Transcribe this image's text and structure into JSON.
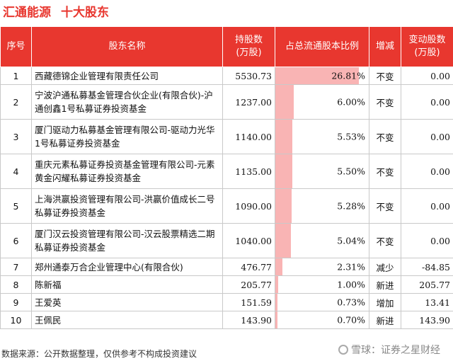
{
  "header": {
    "company": "汇通能源",
    "subtitle": "十大股东"
  },
  "columns": {
    "rank": "序号",
    "name": "股东名称",
    "holding": "持股数\n(万股)",
    "ratio": "占总流通股本比例",
    "change": "增减",
    "change_amount": "变动股数\n(万股)"
  },
  "colors": {
    "header_red": "#e8372f",
    "bar_pink": "#f9b4b4",
    "decrease_green": "#1e9c3a"
  },
  "chart_data": {
    "type": "table",
    "title": "汇通能源 十大股东",
    "rows": [
      {
        "rank": "1",
        "name": "西藏德锦企业管理有限责任公司",
        "holding": "5530.73",
        "ratio": "26.81%",
        "ratio_value": 26.81,
        "change": "不变",
        "change_type": "flat",
        "change_amount": "0.00",
        "tall": false
      },
      {
        "rank": "2",
        "name": "宁波沪通私募基金管理合伙企业(有限合伙)-沪通创鑫1号私募证券投资基金",
        "holding": "1237.00",
        "ratio": "6.00%",
        "ratio_value": 6.0,
        "change": "不变",
        "change_type": "flat",
        "change_amount": "0.00",
        "tall": true
      },
      {
        "rank": "3",
        "name": "厦门驱动力私募基金管理有限公司-驱动力光华1号私募证券投资基金",
        "holding": "1140.00",
        "ratio": "5.53%",
        "ratio_value": 5.53,
        "change": "不变",
        "change_type": "flat",
        "change_amount": "0.00",
        "tall": true
      },
      {
        "rank": "4",
        "name": "重庆元素私募证券投资基金管理有限公司-元素黄金闪耀私募证券投资基金",
        "holding": "1135.00",
        "ratio": "5.50%",
        "ratio_value": 5.5,
        "change": "不变",
        "change_type": "flat",
        "change_amount": "0.00",
        "tall": true
      },
      {
        "rank": "5",
        "name": "上海洪嬴投资管理有限公司-洪嬴价值成长二号私募证券投资基金",
        "holding": "1090.00",
        "ratio": "5.28%",
        "ratio_value": 5.28,
        "change": "不变",
        "change_type": "flat",
        "change_amount": "0.00",
        "tall": true
      },
      {
        "rank": "6",
        "name": "厦门汉云投资管理有限公司-汉云股票精选二期私募证券投资基金",
        "holding": "1040.00",
        "ratio": "5.04%",
        "ratio_value": 5.04,
        "change": "不变",
        "change_type": "flat",
        "change_amount": "0.00",
        "tall": true
      },
      {
        "rank": "7",
        "name": "郑州通泰万合企业管理中心(有限合伙)",
        "holding": "476.77",
        "ratio": "2.31%",
        "ratio_value": 2.31,
        "change": "减少",
        "change_type": "down",
        "change_amount": "-84.85",
        "tall": false
      },
      {
        "rank": "8",
        "name": "陈新福",
        "holding": "205.77",
        "ratio": "1.00%",
        "ratio_value": 1.0,
        "change": "新进",
        "change_type": "up",
        "change_amount": "205.77",
        "tall": false
      },
      {
        "rank": "9",
        "name": "王爱英",
        "holding": "151.59",
        "ratio": "0.73%",
        "ratio_value": 0.73,
        "change": "增加",
        "change_type": "up",
        "change_amount": "13.41",
        "tall": false
      },
      {
        "rank": "10",
        "name": "王佩民",
        "holding": "143.90",
        "ratio": "0.70%",
        "ratio_value": 0.7,
        "change": "新进",
        "change_type": "up",
        "change_amount": "143.90",
        "tall": false
      }
    ],
    "ratio_max": 30
  },
  "footer": {
    "source": "数据来源：公开数据整理，仅供参考不构成投资建议",
    "watermark": "雪球：证券之星财经"
  }
}
